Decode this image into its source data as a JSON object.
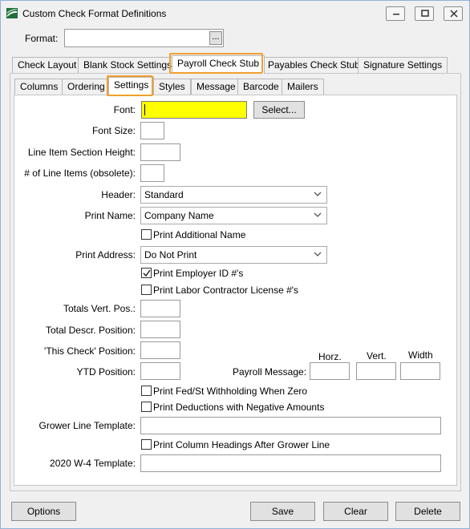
{
  "window": {
    "title": "Custom Check Format Definitions",
    "icon": "app-logo-icon",
    "controls": [
      "minimize-icon",
      "maximize-icon",
      "close-icon"
    ]
  },
  "format": {
    "label": "Format:",
    "value": "",
    "browse_label": "..."
  },
  "main_tabs": [
    "Check Layout",
    "Blank Stock Settings",
    "Payroll Check Stub",
    "Payables Check Stub",
    "Signature Settings"
  ],
  "main_tabs_active": "Payroll Check Stub",
  "sub_tabs": [
    "Columns",
    "Ordering",
    "Settings",
    "Styles",
    "Message",
    "Barcode",
    "Mailers"
  ],
  "sub_tabs_active": "Settings",
  "settings": {
    "font_label": "Font:",
    "font_value": "",
    "select_button": "Select...",
    "font_size_label": "Font Size:",
    "font_size_value": "",
    "line_item_height_label": "Line Item Section Height:",
    "line_item_height_value": "",
    "line_items_label": "# of Line Items (obsolete):",
    "line_items_value": "",
    "header_label": "Header:",
    "header_value": "Standard",
    "print_name_label": "Print Name:",
    "print_name_value": "Company Name",
    "print_additional_name": "Print Additional Name",
    "print_additional_name_checked": false,
    "print_address_label": "Print Address:",
    "print_address_value": "Do Not Print",
    "print_employer_id": "Print Employer ID #'s",
    "print_employer_id_checked": true,
    "print_labor_contractor": "Print Labor Contractor License #'s",
    "print_labor_contractor_checked": false,
    "totals_vert_label": "Totals Vert. Pos.:",
    "totals_vert_value": "",
    "total_descr_label": "Total Descr. Position:",
    "total_descr_value": "",
    "this_check_label": "'This Check' Position:",
    "this_check_value": "",
    "ytd_label": "YTD Position:",
    "ytd_value": "",
    "payroll_message_label": "Payroll Message:",
    "horz_label": "Horz.",
    "vert_label": "Vert.",
    "width_label": "Width",
    "horz_value": "",
    "vert_value": "",
    "width_value": "",
    "print_fed_st": "Print Fed/St Withholding When Zero",
    "print_fed_st_checked": false,
    "print_deductions_negative": "Print Deductions with Negative Amounts",
    "print_deductions_negative_checked": false,
    "grower_line_template_label": "Grower Line Template:",
    "grower_line_template_value": "",
    "print_column_headings": "Print Column Headings After Grower Line",
    "print_column_headings_checked": false,
    "w4_template_label": "2020 W-4 Template:",
    "w4_template_value": ""
  },
  "buttons": {
    "options": "Options",
    "save": "Save",
    "clear": "Clear",
    "delete": "Delete"
  },
  "colors": {
    "highlight": "#f0a030",
    "font_input_bg": "#ffff00"
  }
}
